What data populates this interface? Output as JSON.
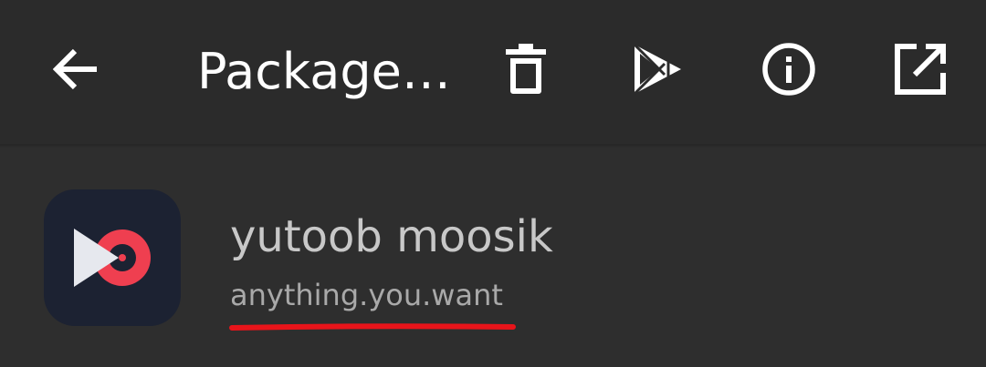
{
  "toolbar": {
    "title": "Package…",
    "back_icon": "arrow-back-icon",
    "actions": [
      {
        "name": "delete-icon"
      },
      {
        "name": "play-store-icon"
      },
      {
        "name": "info-icon"
      },
      {
        "name": "open-external-icon"
      }
    ]
  },
  "app": {
    "name": "yutoob moosik",
    "package": "anything.you.want",
    "icon": "app-logo-icon"
  },
  "colors": {
    "toolbar_bg": "#2b2b2b",
    "content_bg": "#2e2e2e",
    "icon_fg": "#ffffff",
    "app_icon_bg": "#1c2232",
    "app_icon_accent": "#ef3f50",
    "annotation": "#e8141a"
  }
}
